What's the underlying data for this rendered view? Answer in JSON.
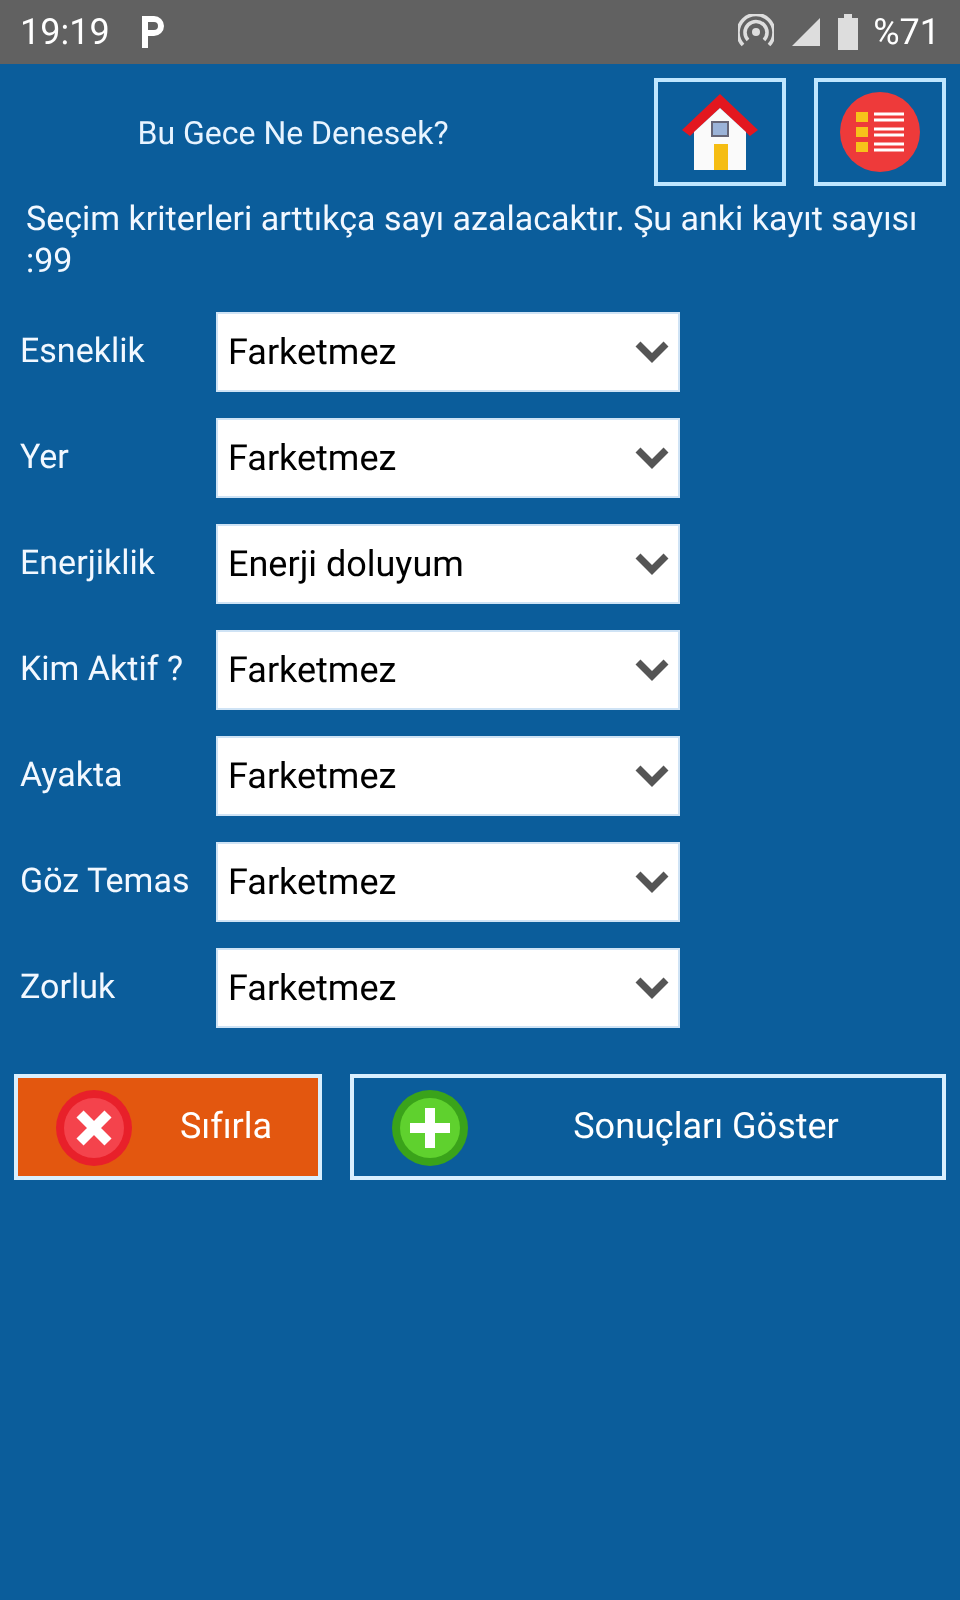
{
  "status_bar": {
    "time": "19:19",
    "battery": "%71"
  },
  "header": {
    "title": "Bu Gece Ne Denesek?"
  },
  "description": "Seçim kriterleri arttıkça sayı azalacaktır. Şu anki kayıt sayısı :99",
  "filters": [
    {
      "label": "Esneklik",
      "value": "Farketmez"
    },
    {
      "label": "Yer",
      "value": "Farketmez"
    },
    {
      "label": "Enerjiklik",
      "value": "Enerji doluyum"
    },
    {
      "label": "Kim Aktif ?",
      "value": "Farketmez"
    },
    {
      "label": "Ayakta",
      "value": "Farketmez"
    },
    {
      "label": "Göz Temas",
      "value": "Farketmez"
    },
    {
      "label": "Zorluk",
      "value": "Farketmez"
    }
  ],
  "buttons": [
    {
      "kind": "reset",
      "label": "Sıfırla"
    },
    {
      "kind": "show",
      "label": "Sonuçları Göster"
    }
  ]
}
